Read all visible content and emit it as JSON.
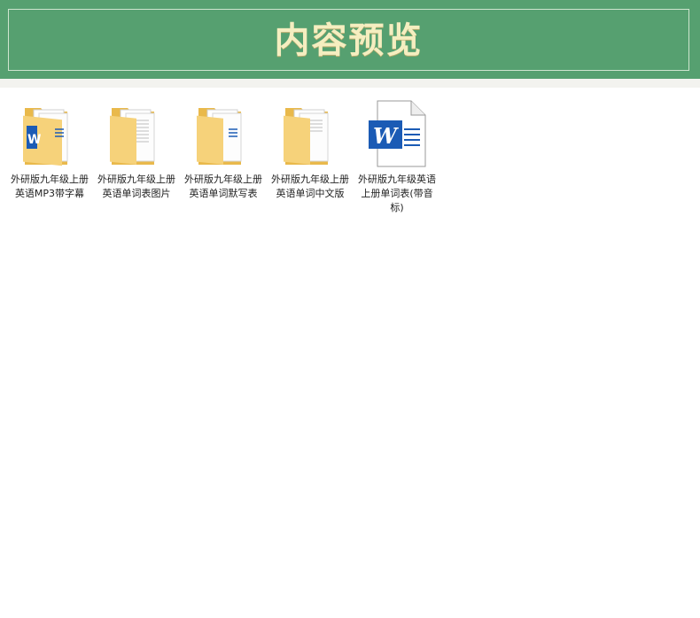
{
  "header": {
    "title": "内容预览"
  },
  "files": [
    {
      "label": "外研版九年级上册英语MP3带字幕",
      "icon": "folder-icon"
    },
    {
      "label": "外研版九年级上册英语单词表图片",
      "icon": "folder-icon"
    },
    {
      "label": "外研版九年级上册英语单词默写表",
      "icon": "folder-icon"
    },
    {
      "label": "外研版九年级上册英语单词中文版",
      "icon": "folder-icon"
    },
    {
      "label": "外研版九年级英语上册单词表(带音标)",
      "icon": "word-document-icon"
    }
  ],
  "colors": {
    "header_bg": "#56a070",
    "title_color": "#f5eec0",
    "folder_yellow": "#f6d27a",
    "word_blue": "#1b5bb5"
  }
}
